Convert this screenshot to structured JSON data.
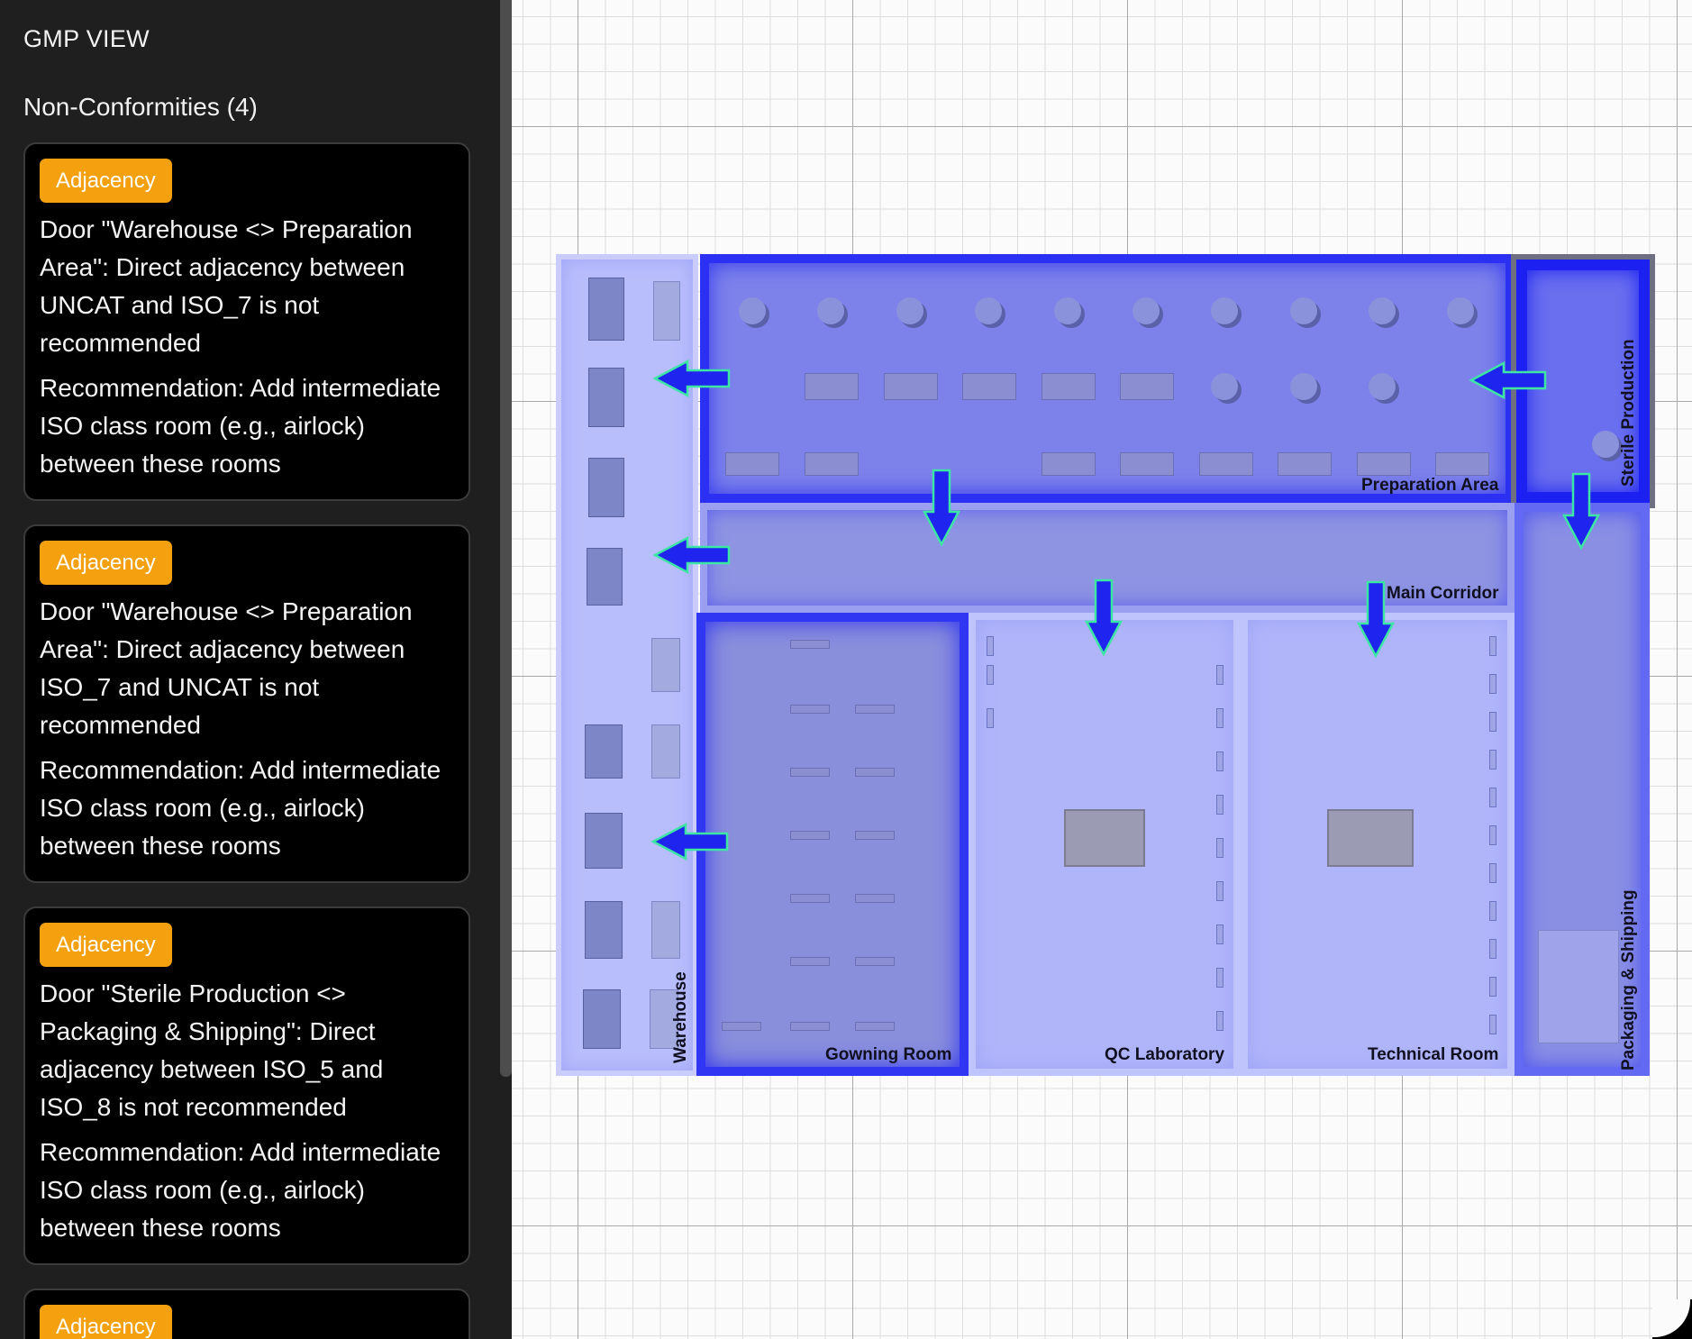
{
  "sidebar": {
    "title": "GMP VIEW",
    "heading": "Non-Conformities (4)",
    "cards": [
      {
        "badge": "Adjacency",
        "text": "Door \"Warehouse <> Preparation Area\": Direct adjacency between UNCAT and ISO_7 is not recommended",
        "recommendation": "Recommendation: Add intermediate ISO class room (e.g., airlock) between these rooms"
      },
      {
        "badge": "Adjacency",
        "text": "Door \"Warehouse <> Preparation Area\": Direct adjacency between ISO_7 and UNCAT is not recommended",
        "recommendation": "Recommendation: Add intermediate ISO class room (e.g., airlock) between these rooms"
      },
      {
        "badge": "Adjacency",
        "text": "Door \"Sterile Production <> Packaging & Shipping\": Direct adjacency between ISO_5 and ISO_8 is not recommended",
        "recommendation": "Recommendation: Add intermediate ISO class room (e.g., airlock) between these rooms"
      },
      {
        "badge": "Adjacency"
      }
    ]
  },
  "plan": {
    "rooms": {
      "warehouse": "Warehouse",
      "preparation_area": "Preparation Area",
      "sterile_production": "Sterile Production",
      "main_corridor": "Main Corridor",
      "gowning_room": "Gowning Room",
      "qc_laboratory": "QC Laboratory",
      "technical_room": "Technical Room",
      "packaging_shipping": "Packaging & Shipping"
    }
  },
  "colors": {
    "badge": "#f5a00e",
    "iso5": "#1d22f0",
    "iso7": "#3a3cf2",
    "iso8": "#6a70f4",
    "uncat": "#b4b9fb",
    "arrow_fill": "#1f24ee",
    "arrow_outline": "#3de6a4"
  },
  "icons": {
    "flow_arrow": "arrow-icon"
  }
}
